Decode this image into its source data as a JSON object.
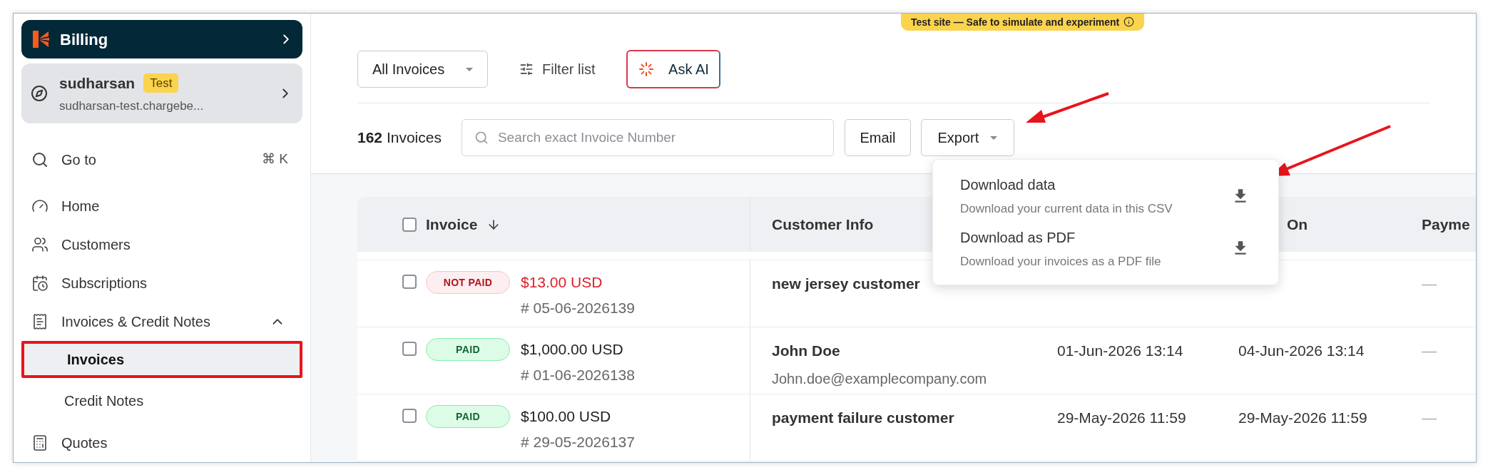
{
  "banner": {
    "text": "Test site — Safe to simulate and experiment"
  },
  "sidebar": {
    "app": {
      "title": "Billing"
    },
    "account": {
      "name": "sudharsan",
      "badge": "Test",
      "site": "sudharsan-test.chargebe..."
    },
    "goto": {
      "label": "Go to",
      "shortcut": "⌘ K"
    },
    "items": [
      {
        "kind": "home",
        "label": "Home"
      },
      {
        "kind": "customers",
        "label": "Customers"
      },
      {
        "kind": "subscriptions",
        "label": "Subscriptions"
      },
      {
        "kind": "invoices",
        "label": "Invoices & Credit Notes",
        "expanded": true,
        "children": [
          {
            "label": "Invoices",
            "selected": true,
            "highlighted": true
          },
          {
            "label": "Credit Notes",
            "selected": false,
            "highlighted": false
          }
        ]
      },
      {
        "kind": "quotes",
        "label": "Quotes"
      }
    ]
  },
  "toolbar": {
    "view": "All Invoices",
    "filter": "Filter list",
    "ask_ai": "Ask AI"
  },
  "list_bar": {
    "count": "162",
    "count_label": "Invoices",
    "search": {
      "placeholder": "Search exact Invoice Number"
    },
    "email": "Email",
    "export": "Export"
  },
  "export_menu": [
    {
      "title": "Download data",
      "description": "Download your current data in this CSV"
    },
    {
      "title": "Download as PDF",
      "description": "Download your invoices as a PDF file"
    }
  ],
  "table": {
    "header": {
      "checked": false,
      "invoice": "Invoice",
      "customer_info": "Customer Info",
      "column_4": "On",
      "column_5": "Payme"
    },
    "rows": [
      {
        "checked": false,
        "status": {
          "kind": "not_paid",
          "label": "NOT PAID"
        },
        "amount": "$13.00 USD",
        "number": "# 05-06-2026139",
        "customer": "new jersey customer",
        "column_5": "—"
      },
      {
        "checked": false,
        "status": {
          "kind": "paid",
          "label": "PAID"
        },
        "amount": "$1,000.00 USD",
        "number": "# 01-06-2026138",
        "customer": "John Doe",
        "email": "John.doe@examplecompany.com",
        "column_3": "01-Jun-2026 13:14",
        "column_4": "04-Jun-2026 13:14",
        "column_5": "—"
      },
      {
        "checked": false,
        "status": {
          "kind": "paid",
          "label": "PAID"
        },
        "amount": "$100.00 USD",
        "number": "# 29-05-2026137",
        "customer": "payment failure customer",
        "column_3": "29-May-2026 11:59",
        "column_4": "29-May-2026 11:59",
        "column_5": "—"
      }
    ]
  }
}
